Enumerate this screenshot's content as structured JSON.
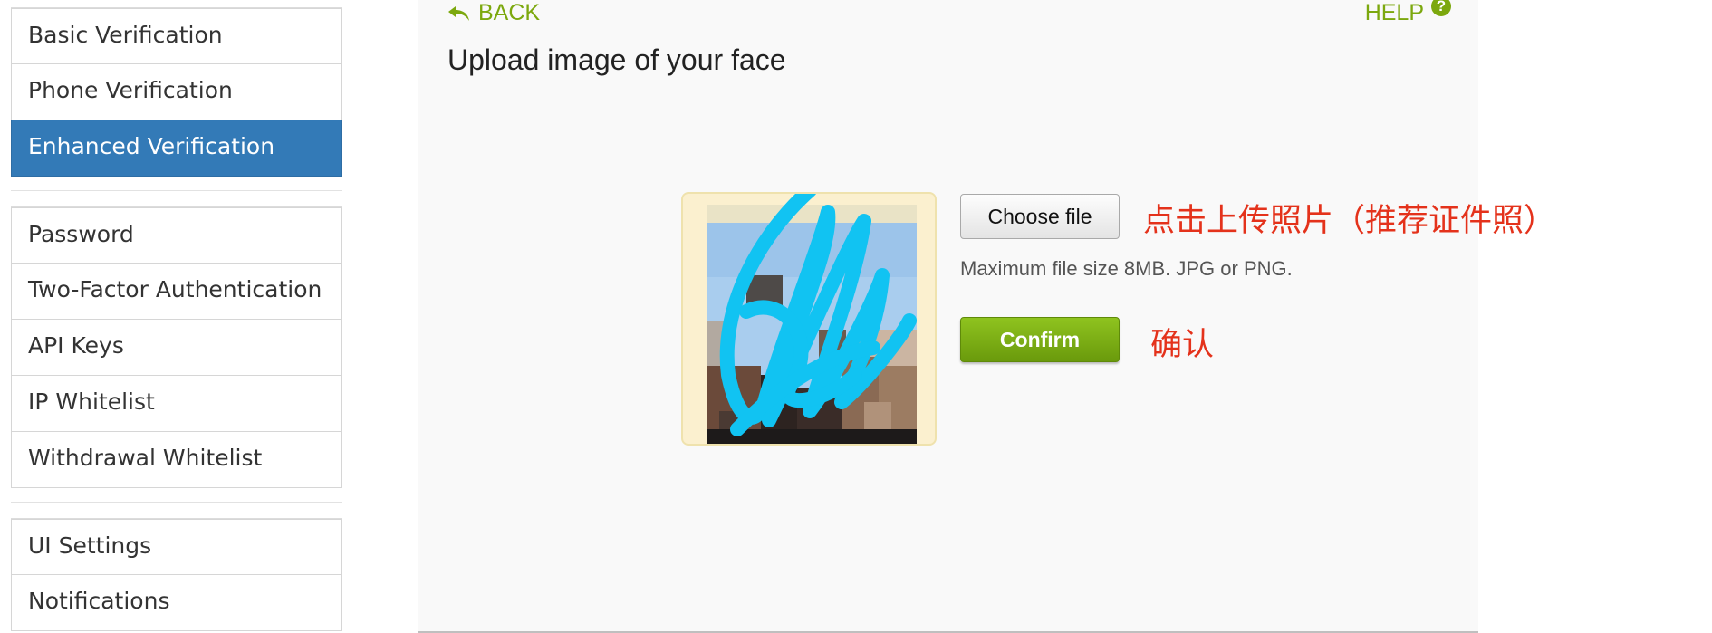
{
  "sidebar": {
    "groups": [
      {
        "items": [
          {
            "label": "Basic Verification",
            "active": false
          },
          {
            "label": "Phone Verification",
            "active": false
          },
          {
            "label": "Enhanced Verification",
            "active": true
          }
        ]
      },
      {
        "items": [
          {
            "label": "Password",
            "active": false
          },
          {
            "label": "Two-Factor Authentication",
            "active": false
          },
          {
            "label": "API Keys",
            "active": false
          },
          {
            "label": "IP Whitelist",
            "active": false
          },
          {
            "label": "Withdrawal Whitelist",
            "active": false
          }
        ]
      },
      {
        "items": [
          {
            "label": "UI Settings",
            "active": false
          },
          {
            "label": "Notifications",
            "active": false
          }
        ]
      }
    ]
  },
  "header": {
    "back_label": "BACK",
    "back_icon": "reply-arrow-icon",
    "help_label": "HELP",
    "help_icon": "question-circle-icon",
    "help_icon_glyph": "?"
  },
  "upload": {
    "title": "Upload image of your face",
    "choose_file_label": "Choose file",
    "file_hint": "Maximum file size 8MB. JPG or PNG.",
    "confirm_label": "Confirm",
    "note_upload": "点击上传照片（推荐证件照）",
    "note_confirm": "确认"
  },
  "colors": {
    "accent_green": "#7ca80e",
    "active_blue": "#337ab7",
    "annotation_red": "#e4321b",
    "scribble_cyan": "#11c3f2"
  }
}
